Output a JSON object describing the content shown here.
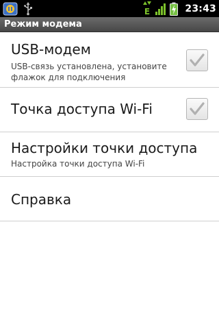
{
  "status_bar": {
    "time": "23:43",
    "network_type": "E",
    "icons": [
      "app-notification-icon",
      "usb-icon",
      "data-transfer-icon",
      "signal-strength-icon",
      "battery-charging-icon"
    ]
  },
  "title_bar": {
    "title": "Режим модема"
  },
  "items": [
    {
      "title": "USB-модем",
      "summary": "USB-связь установлена, установите флажок для подключения",
      "checkbox": "checked"
    },
    {
      "title": "Точка доступа Wi-Fi",
      "checkbox": "checked"
    },
    {
      "title": "Настройки точки доступа",
      "summary": "Настройка точки доступа Wi-Fi"
    },
    {
      "title": "Справка"
    }
  ],
  "colors": {
    "status_bar_bg": "#000000",
    "title_bar_bg": "#555555",
    "divider": "#cfcfcf",
    "check_mark": "#b0b0b0",
    "signal_green": "#7cc12b",
    "battery_green": "#76c043"
  }
}
